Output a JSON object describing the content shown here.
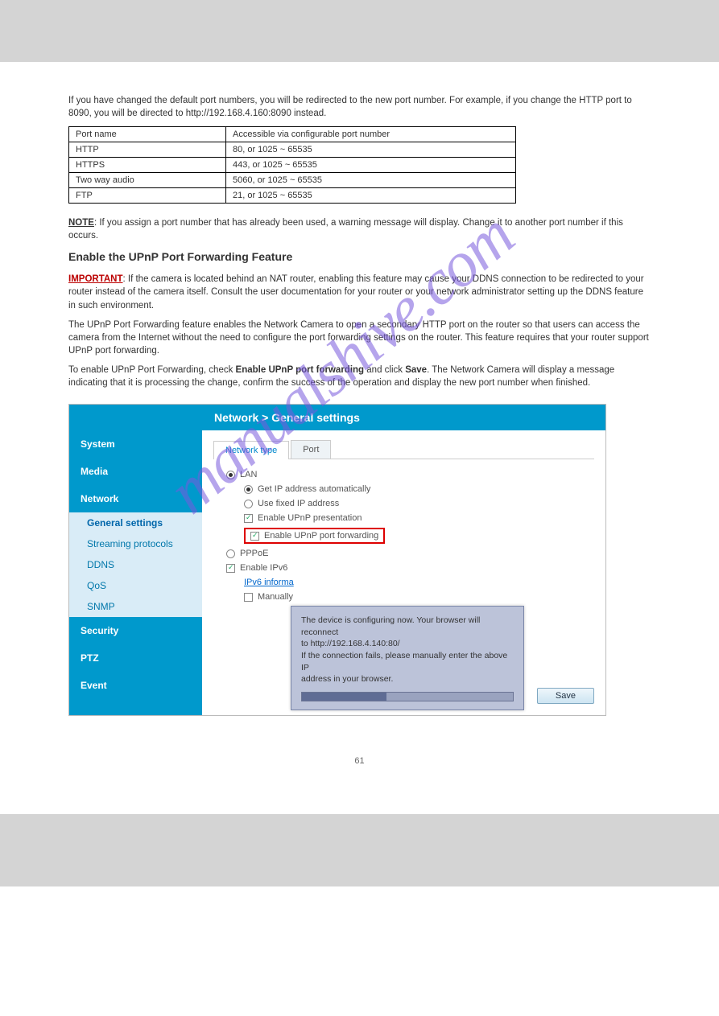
{
  "page": {
    "intro": "If you have changed the default port numbers, you will be redirected to the new port number. For example, if you change the HTTP port to 8090, you will be directed to http://192.168.4.160:8090 instead.",
    "tbl_h1": "Port name",
    "tbl_h2": "Accessible via configurable port number",
    "r1a": "HTTP",
    "r1b": "80, or 1025 ~ 65535",
    "r2a": "HTTPS",
    "r2b": "443, or 1025 ~ 65535",
    "r3a": "Two way audio",
    "r3b": "5060, or 1025 ~ 65535",
    "r4a": "FTP",
    "r4b": "21, or 1025 ~ 65535",
    "note_label": "NOTE",
    "note_text": ": If you assign a port number that has already been used, a warning message will display. Change it to another port number if this occurs."
  },
  "section": {
    "heading": "Enable the UPnP Port Forwarding Feature",
    "import_label": "IMPORTANT",
    "import_text": ": If the camera is located behind an NAT router, enabling this feature may cause your DDNS connection to be redirected to your router instead of the camera itself. Consult the user documentation for your router or your network administrator setting up the DDNS feature in such environment.",
    "p1": "The UPnP Port Forwarding feature enables the Network Camera to open a secondary HTTP port on the router so that users can access the camera from the Internet without the need to configure the port forwarding settings on the router. This feature requires that your router support UPnP port forwarding.",
    "p2a": "To enable UPnP Port Forwarding, check ",
    "p2b": "Enable UPnP port forwarding",
    "p2c": " and click ",
    "p2d": "Save",
    "p2e": ". The Network Camera will display a message indicating that it is processing the change, confirm the success of the operation and display the new port number when finished."
  },
  "shot": {
    "crumb": "Network  > General settings",
    "side": {
      "system": "System",
      "media": "Media",
      "network": "Network",
      "gs": "General settings",
      "stream": "Streaming protocols",
      "ddns": "DDNS",
      "qos": "QoS",
      "snmp": "SNMP",
      "security": "Security",
      "ptz": "PTZ",
      "event": "Event"
    },
    "tabs": {
      "nt": "Network type",
      "port": "Port"
    },
    "opts": {
      "lan": "LAN",
      "auto": "Get IP address automatically",
      "fixed": "Use fixed IP address",
      "upnp_pres": "Enable UPnP presentation",
      "upnp_fwd": "Enable UPnP port forwarding",
      "pppoe": "PPPoE",
      "ipv6": "Enable IPv6",
      "ipv6info": "IPv6 informa",
      "manual": "Manually"
    },
    "popup": {
      "l1": "The device is configuring now. Your browser will reconnect",
      "l2": "to http://192.168.4.140:80/",
      "l3": "If the connection fails, please manually enter the above IP",
      "l4": "address in your browser."
    },
    "save": "Save"
  },
  "page_num": "61"
}
